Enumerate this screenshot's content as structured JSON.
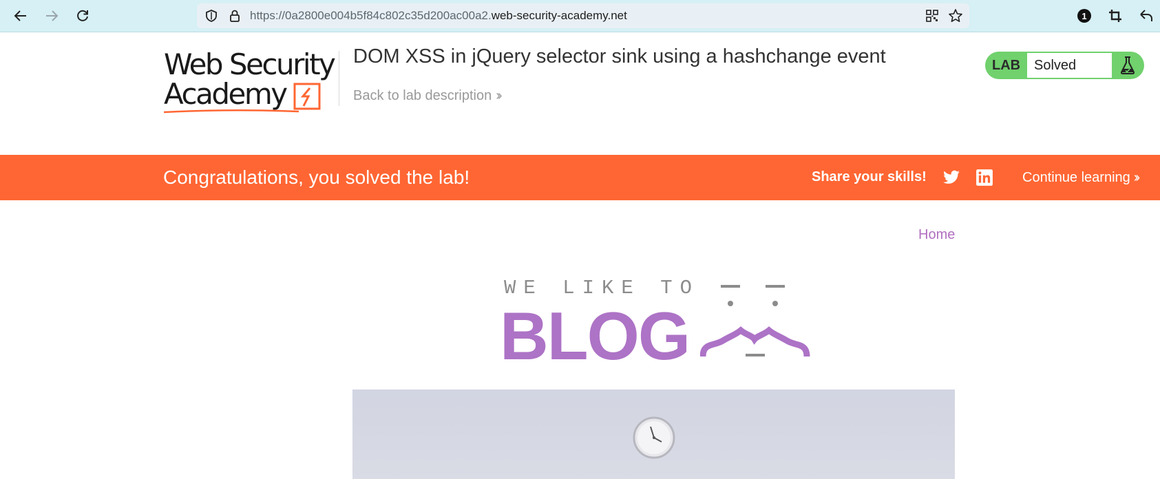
{
  "browser": {
    "url_prefix": "https://0a2800e004b5f84c802c35d200ac00a2.",
    "url_domain": "web-security-academy.net",
    "notification_count": "1"
  },
  "academy": {
    "logo_line1": "Web Security",
    "logo_line2": "Academy",
    "lab_title": "DOM XSS in jQuery selector sink using a hashchange event",
    "back_link": "Back to lab description",
    "badge_label": "LAB",
    "badge_status": "Solved",
    "badge_color": "#70d16d"
  },
  "banner": {
    "message": "Congratulations, you solved the lab!",
    "share_label": "Share your skills!",
    "continue_label": "Continue learning",
    "color": "#ff6633"
  },
  "blog": {
    "home_link": "Home",
    "tagline": "WE LIKE TO",
    "title": "BLOG",
    "accent_color": "#ad73c6"
  }
}
